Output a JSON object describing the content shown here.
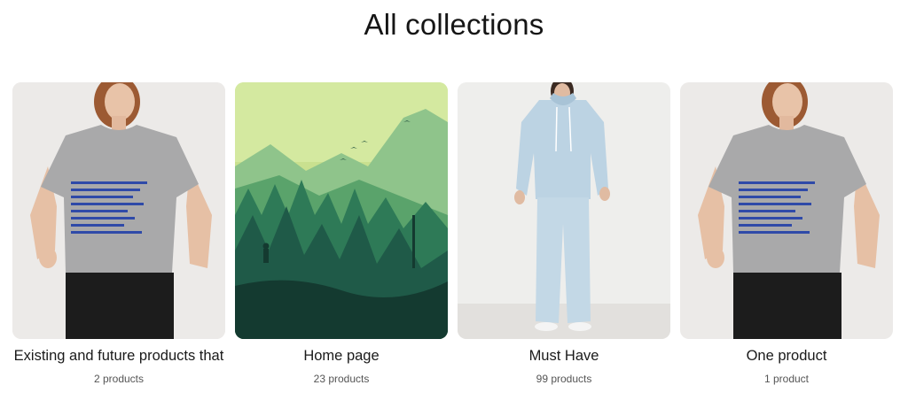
{
  "page": {
    "title": "All collections"
  },
  "collections": [
    {
      "title": "Existing and future products that",
      "count": "2 products",
      "image": "grey-tshirt-model"
    },
    {
      "title": "Home page",
      "count": "23 products",
      "image": "green-forest-landscape"
    },
    {
      "title": "Must Have",
      "count": "99 products",
      "image": "light-blue-tracksuit-model"
    },
    {
      "title": "One product",
      "count": "1 product",
      "image": "grey-tshirt-model"
    }
  ],
  "colors": {
    "text": "#1a1a1a",
    "muted": "#555555",
    "photo_bg": "#e9e7e5",
    "tshirt": "#a9a9aa",
    "hoodie": "#bcd3e3",
    "forest_sky": "#c9e08f"
  }
}
